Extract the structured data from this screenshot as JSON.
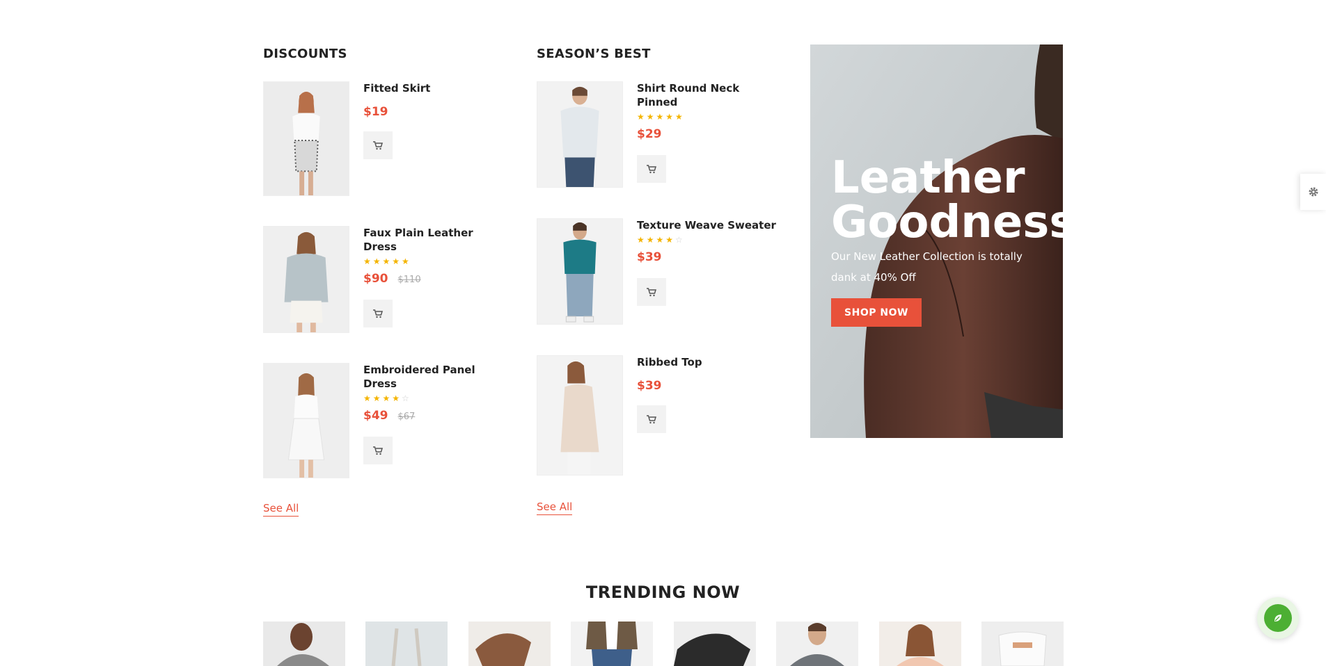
{
  "discounts": {
    "title": "DISCOUNTS",
    "products": [
      {
        "name": "Fitted Skirt",
        "price": "$19",
        "old_price": "",
        "rating": 0
      },
      {
        "name": "Faux Plain Leather Dress",
        "price": "$90",
        "old_price": "$110",
        "rating": 5
      },
      {
        "name": "Embroidered Panel Dress",
        "price": "$49",
        "old_price": "$67",
        "rating": 4
      }
    ],
    "see_all": "See All"
  },
  "seasons_best": {
    "title": "SEASON’S BEST",
    "products": [
      {
        "name": "Shirt Round Neck Pinned",
        "price": "$29",
        "rating": 5
      },
      {
        "name": "Texture Weave Sweater",
        "price": "$39",
        "rating": 4
      },
      {
        "name": "Ribbed Top",
        "price": "$39",
        "rating": 0
      }
    ],
    "see_all": "See All"
  },
  "banner": {
    "title_line1": "Leather",
    "title_line2": "Goodness",
    "description": "Our New Leather Collection is totally dank at 40% Off",
    "button": "SHOP NOW"
  },
  "trending": {
    "title": "TRENDING NOW"
  },
  "colors": {
    "accent": "#e8513a",
    "star": "#f4b400",
    "fab": "#4caf33"
  },
  "icons": {
    "cart": "cart-icon",
    "settings": "gear-icon",
    "fab": "leaf-icon"
  }
}
